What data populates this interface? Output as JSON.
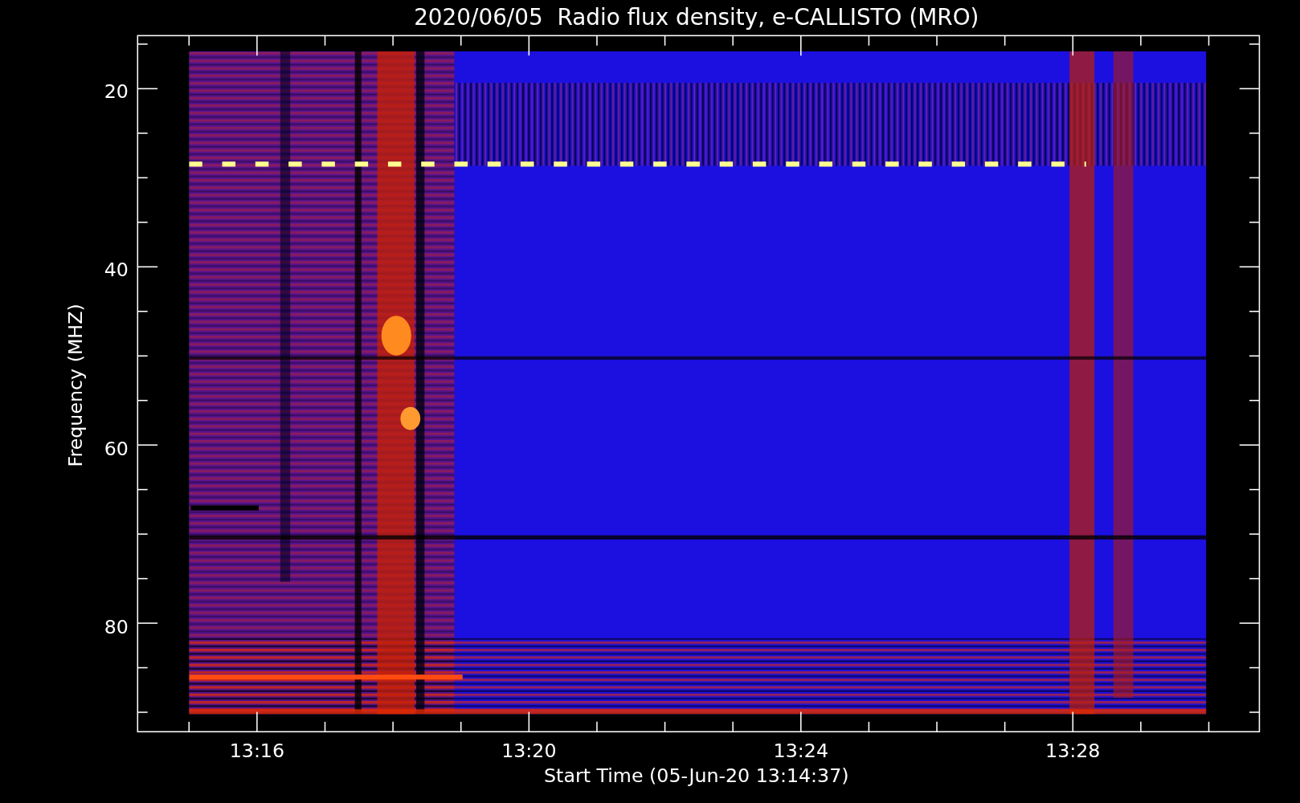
{
  "title": "2020/06/05  Radio flux density, e-CALLISTO (MRO)",
  "ylabel": "Frequency (MHZ)",
  "xlabel": "Start Time (05-Jun-20 13:14:37)",
  "yticks": [
    "20",
    "40",
    "60",
    "80"
  ],
  "xticks": [
    "13:16",
    "13:20",
    "13:24",
    "13:28"
  ]
}
